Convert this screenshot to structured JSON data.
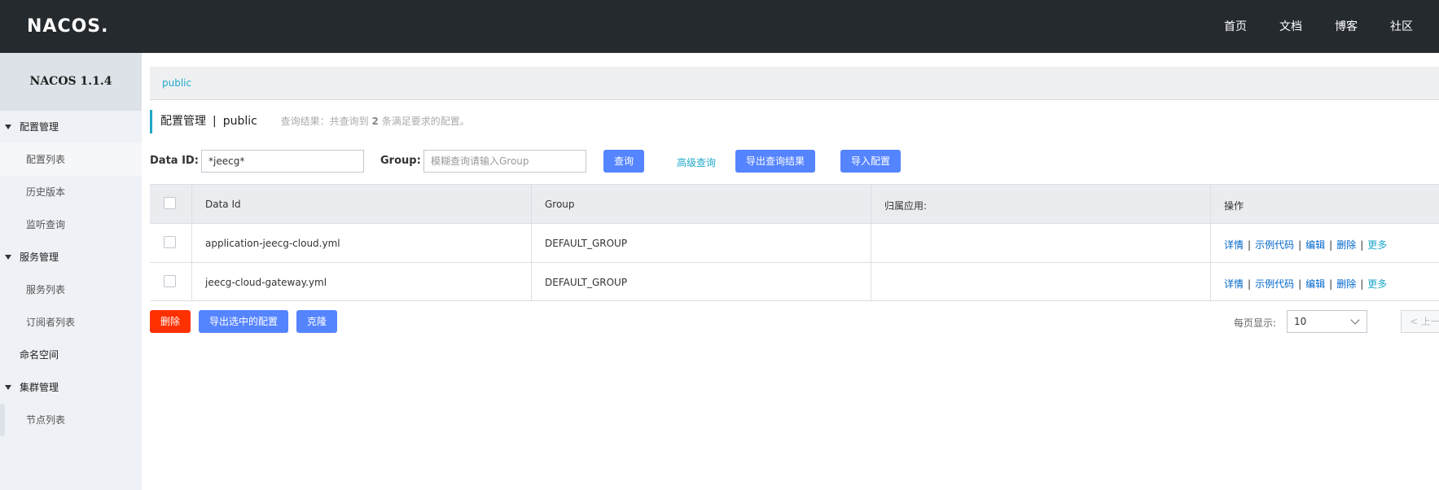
{
  "header": {
    "logo": "NACOS.",
    "nav": [
      "首页",
      "文档",
      "博客",
      "社区"
    ]
  },
  "sidebar": {
    "title": "NACOS 1.1.4",
    "groups": [
      {
        "label": "配置管理",
        "items": [
          "配置列表",
          "历史版本",
          "监听查询"
        ]
      },
      {
        "label": "服务管理",
        "items": [
          "服务列表",
          "订阅者列表"
        ]
      },
      {
        "label": "命名空间"
      },
      {
        "label": "集群管理",
        "items": [
          "节点列表"
        ]
      }
    ],
    "active_item": "配置列表"
  },
  "breadcrumb": {
    "namespace": "public"
  },
  "title": {
    "main": "配置管理",
    "separator": "|",
    "namespace": "public",
    "hint_prefix": "查询结果：共查询到",
    "hint_count": "2",
    "hint_suffix": "条满足要求的配置。"
  },
  "search": {
    "data_id_label": "Data ID:",
    "data_id_value": "*jeecg*",
    "group_label": "Group:",
    "group_placeholder": "模糊查询请输入Group",
    "query_button": "查询",
    "advanced_link": "高级查询",
    "export_result_button": "导出查询结果",
    "import_button": "导入配置"
  },
  "table": {
    "columns": [
      "Data Id",
      "Group",
      "归属应用:",
      "操作"
    ],
    "rows": [
      {
        "data_id": "application-jeecg-cloud.yml",
        "group": "DEFAULT_GROUP",
        "app": ""
      },
      {
        "data_id": "jeecg-cloud-gateway.yml",
        "group": "DEFAULT_GROUP",
        "app": ""
      }
    ],
    "actions": [
      "详情",
      "示例代码",
      "编辑",
      "删除",
      "更多"
    ]
  },
  "bulk": {
    "delete_button": "删除",
    "export_selected_button": "导出选中的配置",
    "clone_button": "克隆"
  },
  "pagination": {
    "page_size_label": "每页显示:",
    "page_size": "10",
    "prev_label": "上一"
  },
  "colors": {
    "header_bg": "#252a2f",
    "primary": "#5584ff",
    "danger": "#ff3000",
    "link": "#1fa8c8",
    "action_link": "#0066cc"
  }
}
